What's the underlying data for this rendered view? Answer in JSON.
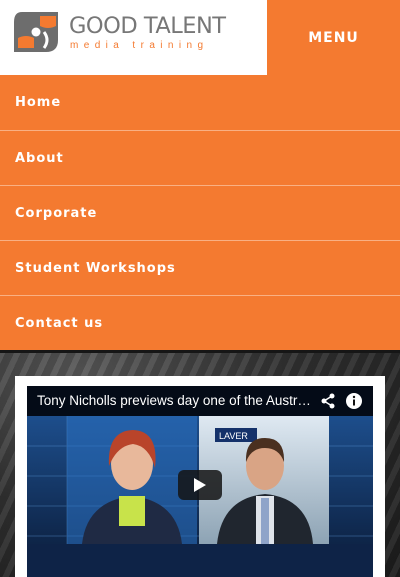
{
  "header": {
    "brand_name": "GOOD TALENT",
    "brand_tagline": "media training",
    "menu_label": "MENU"
  },
  "nav": {
    "items": [
      {
        "label": "Home"
      },
      {
        "label": "About"
      },
      {
        "label": "Corporate"
      },
      {
        "label": "Student Workshops"
      },
      {
        "label": "Contact us"
      }
    ]
  },
  "video": {
    "title": "Tony Nicholls previews day one of the Austra...",
    "backdrop_sign": "LAVER"
  },
  "colors": {
    "accent": "#f47a30",
    "logo_grey": "#777777",
    "nav_divider": "#f9b083"
  },
  "icons": [
    "logo-mark-icon",
    "share-icon",
    "info-icon",
    "play-icon"
  ]
}
